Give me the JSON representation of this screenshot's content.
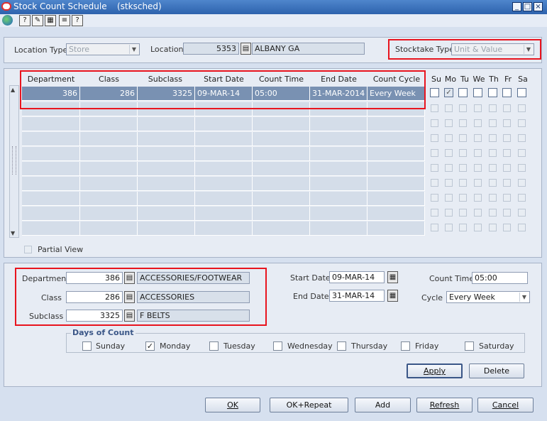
{
  "window": {
    "title": "Stock Count Schedule",
    "module": "(stksched)"
  },
  "toolbar": {
    "icons": [
      "globe-icon",
      "help-icon",
      "tools-icon",
      "calculator-icon",
      "notes-icon",
      "question-icon"
    ]
  },
  "location_bar": {
    "location_type_label": "Location Type",
    "location_type_value": "Store",
    "location_label": "Location",
    "location_id": "5353",
    "location_name": "ALBANY GA",
    "stocktake_type_label": "Stocktake Type",
    "stocktake_type_value": "Unit & Value"
  },
  "grid": {
    "columns": [
      "Department",
      "Class",
      "Subclass",
      "Start Date",
      "Count Time",
      "End Date",
      "Count Cycle"
    ],
    "day_columns": [
      "Su",
      "Mo",
      "Tu",
      "We",
      "Th",
      "Fr",
      "Sa"
    ],
    "rows": [
      {
        "department": "386",
        "class": "286",
        "subclass": "3325",
        "start_date": "09-MAR-14",
        "count_time": "05:00",
        "end_date": "31-MAR-2014",
        "count_cycle": "Every Week",
        "days": [
          false,
          true,
          false,
          false,
          false,
          false,
          false
        ]
      }
    ],
    "partial_view_label": "Partial View"
  },
  "detail": {
    "department_label": "Department",
    "department_value": "386",
    "department_desc": "ACCESSORIES/FOOTWEAR",
    "class_label": "Class",
    "class_value": "286",
    "class_desc": "ACCESSORIES",
    "subclass_label": "Subclass",
    "subclass_value": "3325",
    "subclass_desc": "F BELTS",
    "start_date_label": "Start Date",
    "start_date_value": "09-MAR-14",
    "end_date_label": "End Date",
    "end_date_value": "31-MAR-14",
    "count_time_label": "Count Time",
    "count_time_value": "05:00",
    "cycle_label": "Cycle",
    "cycle_value": "Every Week"
  },
  "days_of_count": {
    "title": "Days of Count",
    "days": [
      {
        "label": "Sunday",
        "checked": false
      },
      {
        "label": "Monday",
        "checked": true
      },
      {
        "label": "Tuesday",
        "checked": false
      },
      {
        "label": "Wednesday",
        "checked": false
      },
      {
        "label": "Thursday",
        "checked": false
      },
      {
        "label": "Friday",
        "checked": false
      },
      {
        "label": "Saturday",
        "checked": false
      }
    ]
  },
  "buttons": {
    "apply": "Apply",
    "delete": "Delete",
    "ok": "OK",
    "ok_repeat": "OK+Repeat",
    "add": "Add",
    "refresh": "Refresh",
    "cancel": "Cancel"
  }
}
